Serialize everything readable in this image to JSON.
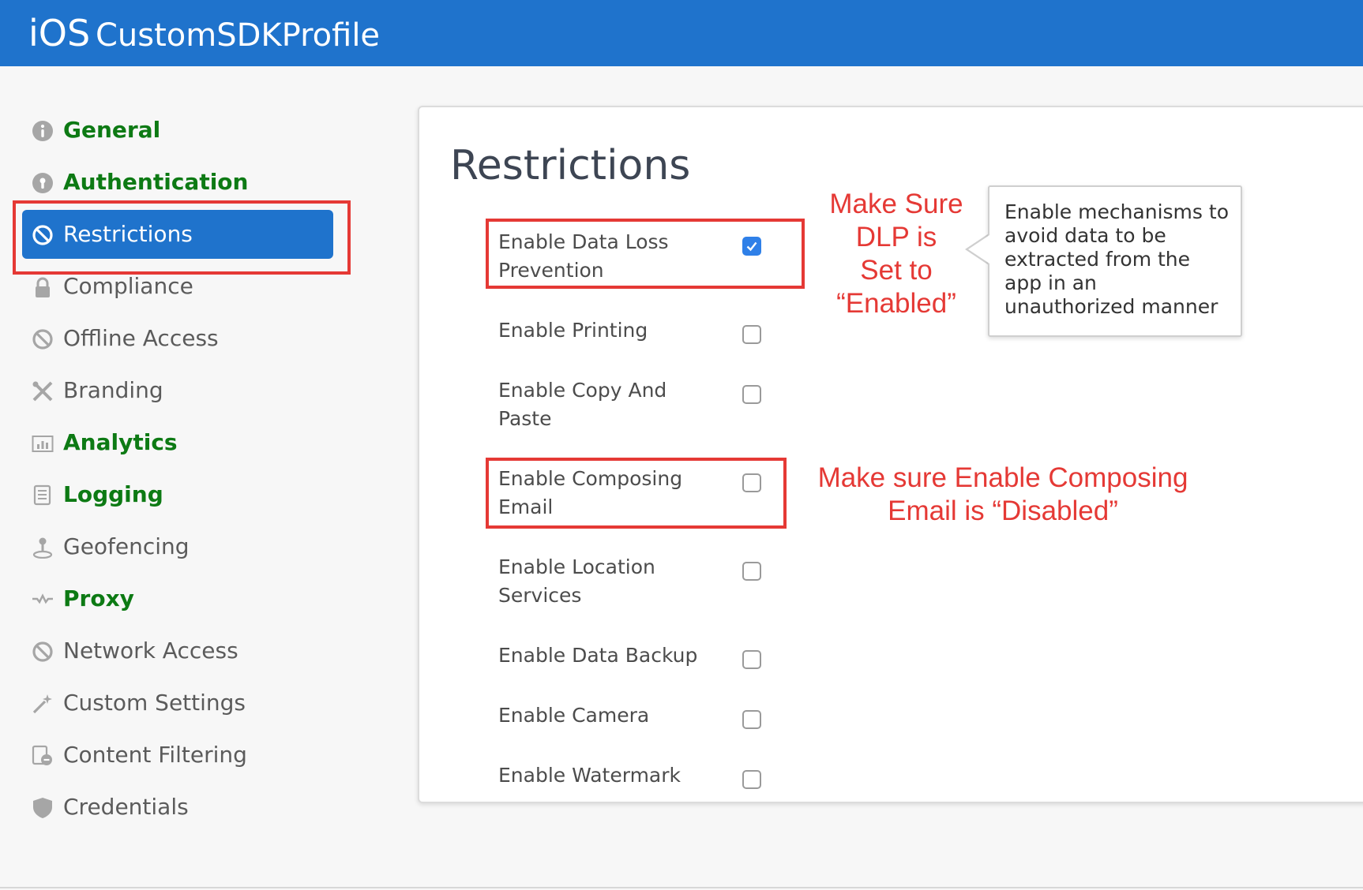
{
  "header": {
    "platform": "iOS",
    "profile_name": "CustomSDKProfile",
    "bar_color": "#1f73cc"
  },
  "sidebar": {
    "items": [
      {
        "label": "General",
        "icon": "info-icon",
        "state": "configured"
      },
      {
        "label": "Authentication",
        "icon": "lock-round-icon",
        "state": "configured"
      },
      {
        "label": "Restrictions",
        "icon": "restricted-icon",
        "state": "active"
      },
      {
        "label": "Compliance",
        "icon": "padlock-icon",
        "state": "default"
      },
      {
        "label": "Offline Access",
        "icon": "restricted-icon",
        "state": "default"
      },
      {
        "label": "Branding",
        "icon": "tools-icon",
        "state": "default"
      },
      {
        "label": "Analytics",
        "icon": "chart-icon",
        "state": "configured"
      },
      {
        "label": "Logging",
        "icon": "scroll-icon",
        "state": "configured"
      },
      {
        "label": "Geofencing",
        "icon": "pin-icon",
        "state": "default"
      },
      {
        "label": "Proxy",
        "icon": "wave-icon",
        "state": "configured"
      },
      {
        "label": "Network Access",
        "icon": "restricted-icon",
        "state": "default"
      },
      {
        "label": "Custom Settings",
        "icon": "magic-wand-icon",
        "state": "default"
      },
      {
        "label": "Content Filtering",
        "icon": "filter-doc-icon",
        "state": "default"
      },
      {
        "label": "Credentials",
        "icon": "shield-icon",
        "state": "default"
      }
    ],
    "configured_color": "#0d7a14",
    "active_color": "#1f73cc"
  },
  "main": {
    "title": "Restrictions",
    "options": [
      {
        "label": "Enable Data Loss Prevention",
        "checked": true
      },
      {
        "label": "Enable Printing",
        "checked": false
      },
      {
        "label": "Enable Copy And Paste",
        "checked": false
      },
      {
        "label": "Enable Composing Email",
        "checked": false
      },
      {
        "label": "Enable Location Services",
        "checked": false
      },
      {
        "label": "Enable Data Backup",
        "checked": false
      },
      {
        "label": "Enable Camera",
        "checked": false
      },
      {
        "label": "Enable Watermark",
        "checked": false
      }
    ],
    "checkbox_color": "#2f80e8"
  },
  "annotations": {
    "dlp_note": [
      "Make Sure",
      "DLP is",
      "Set to",
      "“Enabled”"
    ],
    "email_note": [
      "Make sure Enable Composing",
      "Email is “Disabled”"
    ],
    "tooltip": "Enable mechanisms to avoid data to be extracted from the app in an unauthorized manner",
    "highlight_color": "#e53935"
  }
}
